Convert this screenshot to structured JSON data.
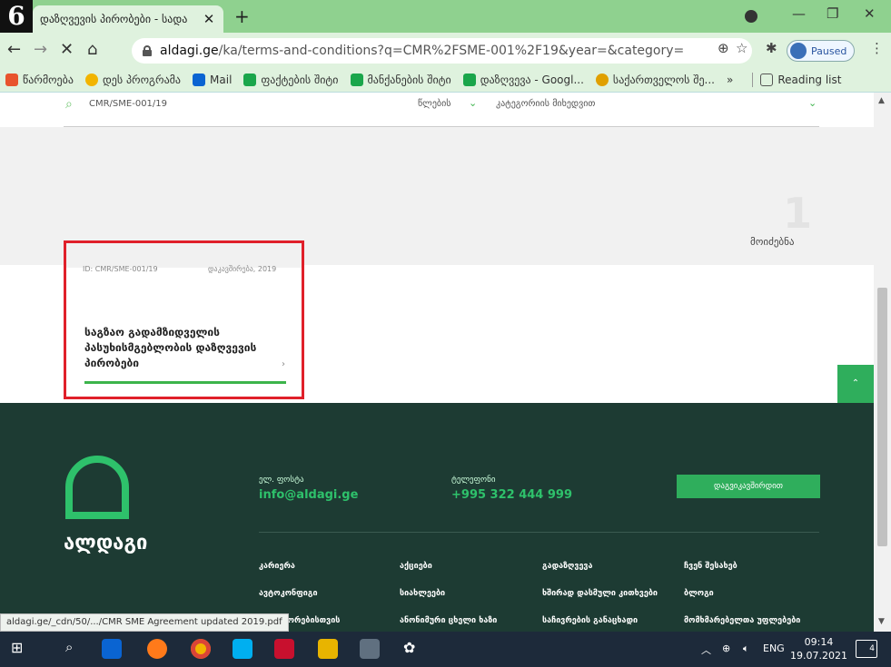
{
  "step_badge": "6",
  "browser": {
    "tab_title": "დაზღვევის პირობები - სადა ",
    "address_host": "aldagi.ge",
    "address_path": "/ka/terms-and-conditions?q=CMR%2FSME-001%2F19&year=&category=",
    "paused_label": "Paused",
    "bookmarks": [
      {
        "label": "წარმოება",
        "icon": "apps-icon",
        "color": "#e8542d"
      },
      {
        "label": "დეს პროგრამა",
        "icon": "course-icon",
        "color": "#f2b400"
      },
      {
        "label": "Mail",
        "icon": "outlook-icon",
        "color": "#0a64d2"
      },
      {
        "label": "ფაქტების შიტი",
        "icon": "sheets-icon",
        "color": "#1aa64b"
      },
      {
        "label": "მანქანების შიტი",
        "icon": "sheets-icon",
        "color": "#1aa64b"
      },
      {
        "label": "დაზღვევა - Googl...",
        "icon": "sheets-icon",
        "color": "#1aa64b"
      },
      {
        "label": "საქართველოს შე...",
        "icon": "flag-icon",
        "color": "#e0a000"
      }
    ],
    "bookmarks_more": "»",
    "reading_list": "Reading list"
  },
  "page": {
    "search_query": "CMR/SME-001/19",
    "year_filter": "წლების",
    "category_filter": "კატეგორიის მიხედვით",
    "results_count": "1",
    "results_label": "მოიძებნა",
    "card": {
      "id_label": "ID: CMR/SME-001/19",
      "category": "დაკავშირება, 2019",
      "title": "საგზაო გადამზიდველის პასუხისმგებლობის დაზღვევის პირობები",
      "arrow": "›"
    },
    "scroll_top": "⌃"
  },
  "footer": {
    "email_label": "ელ. ფოსტა",
    "email": "info@aldagi.ge",
    "phone_label": "ტელეფონი",
    "phone": "+995 322 444 999",
    "contact_button": "დაგვიკავშირდით",
    "logo_text": "ალდაგი",
    "links": [
      [
        "კარიერა",
        "აქციები",
        "გადაზღვევა",
        "ჩვენ შესახებ"
      ],
      [
        "ავტოკონფიგი",
        "სიახლეები",
        "ხშირად დასმული კითხვები",
        "ბლოგი"
      ],
      [
        "ინვესტორებისთვის",
        "ანონიმური ცხელი ხაზი",
        "საჩივრების განაცხადი",
        "მომხმარებელთა უფლებები"
      ]
    ]
  },
  "status_url": "aldagi.ge/_cdn/50/.../CMR SME Agreement updated 2019.pdf",
  "taskbar": {
    "lang": "ENG",
    "time": "09:14",
    "date": "19.07.2021",
    "notifications": "4"
  }
}
